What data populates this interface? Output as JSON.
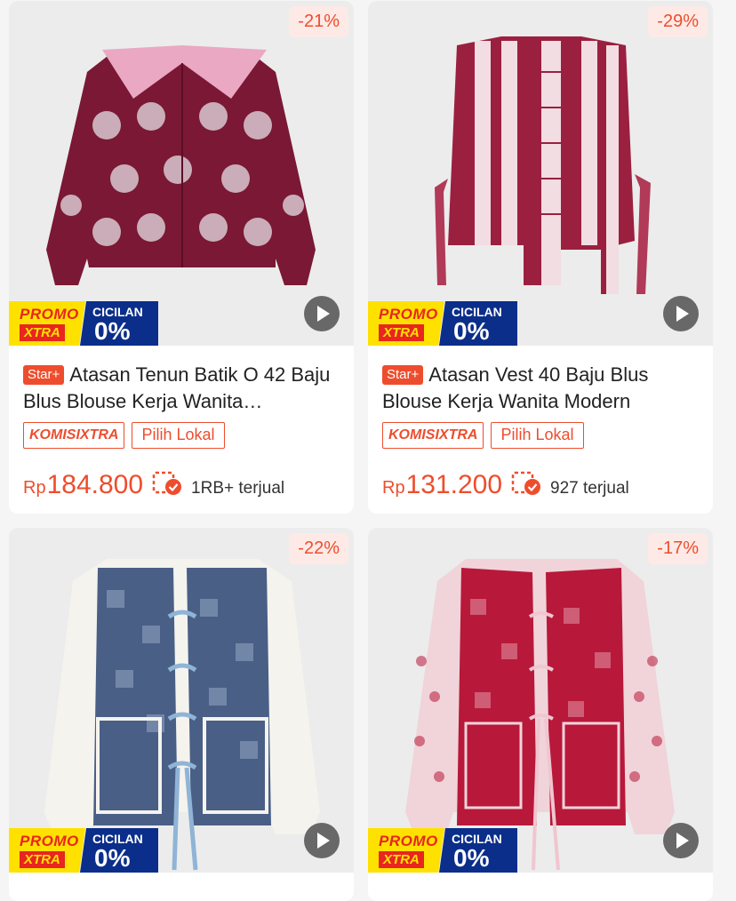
{
  "products": [
    {
      "discount": "-21%",
      "star_badge": "Star+",
      "title": "Atasan Tenun Batik O 42 Baju Blus Blouse Kerja Wanita…",
      "komisi": "KOMISIXTRA",
      "lokal": "Pilih Lokal",
      "currency": "Rp",
      "price": "184.800",
      "sold": "1RB+ terjual",
      "promo_top": "PROMO",
      "promo_bottom": "XTRA",
      "cicilan_top": "CICILAN",
      "cicilan_bottom": "0%",
      "garment_color": "#7a1835",
      "pattern_color": "#d8c8cf",
      "icon": "play-icon"
    },
    {
      "discount": "-29%",
      "star_badge": "Star+",
      "title": "Atasan Vest 40  Baju Blus Blouse Kerja Wanita Modern",
      "komisi": "KOMISIXTRA",
      "lokal": "Pilih Lokal",
      "currency": "Rp",
      "price": "131.200",
      "sold": "927 terjual",
      "promo_top": "PROMO",
      "promo_bottom": "XTRA",
      "cicilan_top": "CICILAN",
      "cicilan_bottom": "0%",
      "garment_color": "#9b2040",
      "pattern_color": "#f1dde2",
      "icon": "play-icon"
    },
    {
      "discount": "-22%",
      "promo_top": "PROMO",
      "promo_bottom": "XTRA",
      "cicilan_top": "CICILAN",
      "cicilan_bottom": "0%",
      "garment_color": "#4a5f86",
      "pattern_color": "#f5f3ee",
      "icon": "play-icon"
    },
    {
      "discount": "-17%",
      "promo_top": "PROMO",
      "promo_bottom": "XTRA",
      "cicilan_top": "CICILAN",
      "cicilan_bottom": "0%",
      "garment_color": "#b8183a",
      "pattern_color": "#f0d4da",
      "icon": "play-icon"
    }
  ],
  "colors": {
    "accent": "#ee4d2d",
    "promo_yellow": "#ffe100",
    "promo_navy": "#0b2e8a"
  }
}
